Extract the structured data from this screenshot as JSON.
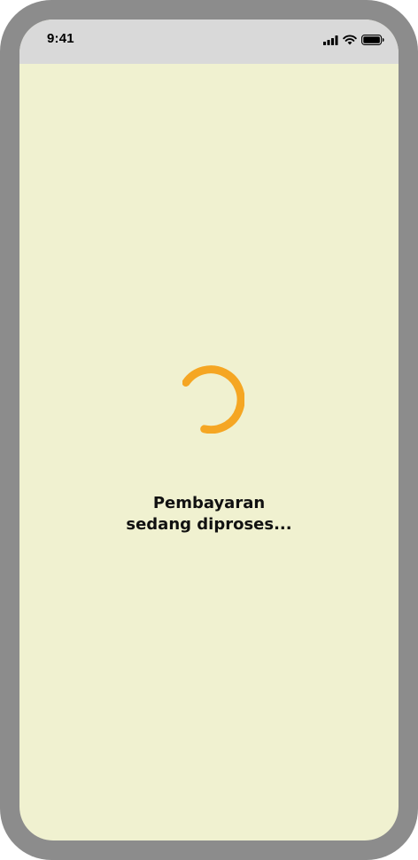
{
  "status_bar": {
    "time": "9:41",
    "icons": [
      "cellular-signal-icon",
      "wifi-icon",
      "battery-icon"
    ]
  },
  "loader": {
    "icon": "loading-spinner-icon",
    "color": "#f5a623"
  },
  "message": {
    "line1": "Pembayaran",
    "line2": "sedang diproses..."
  },
  "colors": {
    "screen_background": "#f0f1d0",
    "status_bar_background": "#d9d9d9",
    "device_frame": "#8c8c8c"
  }
}
